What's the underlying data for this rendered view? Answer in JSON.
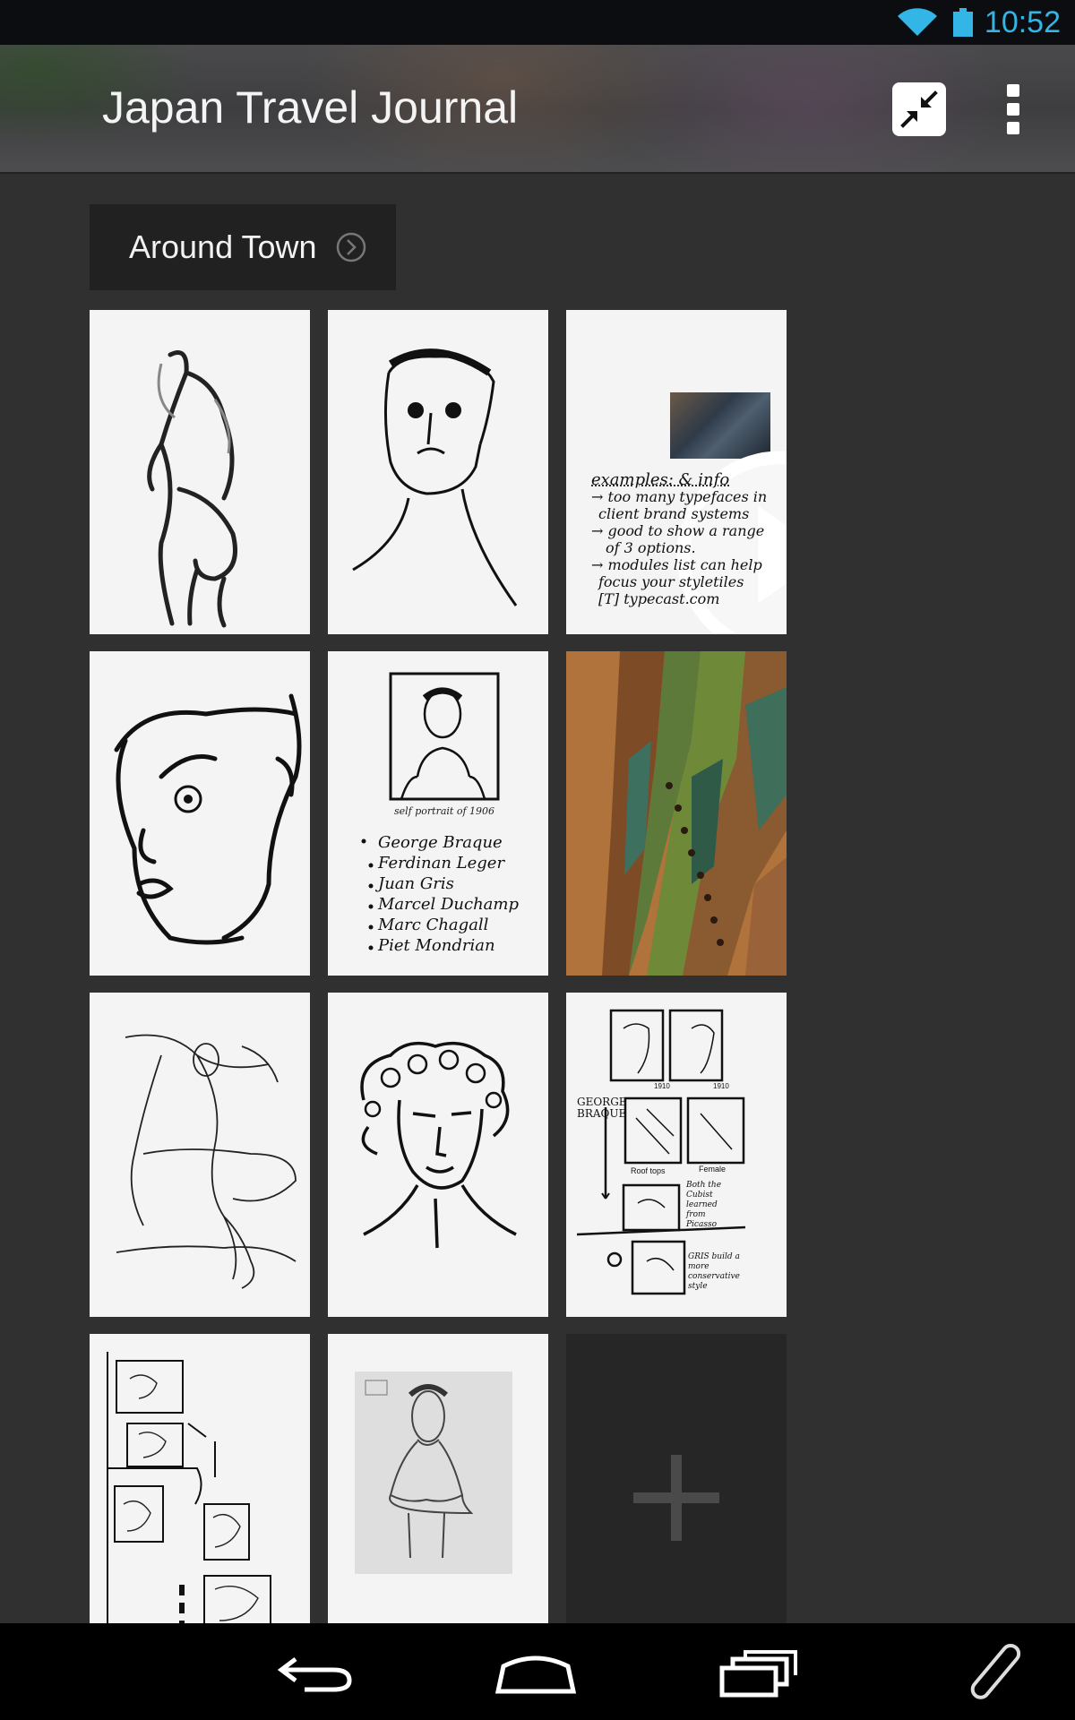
{
  "status_bar": {
    "time": "10:52",
    "icons": [
      "wifi-icon",
      "battery-icon"
    ],
    "accent_color": "#33b5e5"
  },
  "action_bar": {
    "title": "Japan Travel Journal",
    "actions": [
      "collapse-icon",
      "overflow-menu-icon"
    ]
  },
  "section": {
    "label": "Around Town",
    "icon": "chevron-right-circle-icon"
  },
  "notes_tile": {
    "heading": "examples: & info",
    "lines": [
      "→ too many typefaces in",
      "client brand systems",
      "→ good to show a range",
      "of 3 options.",
      "→ modules list can help",
      "focus your styletiles",
      "[T] typecast.com"
    ]
  },
  "list_tile": {
    "caption": "self portrait of 1906",
    "names": [
      "George Braque",
      "Ferdinan Leger",
      "Juan Gris",
      "Marcel Duchamp",
      "Marc Chagall",
      "Piet Mondrian"
    ]
  },
  "study_tile": {
    "side_label": "GEORGE BRAQUE",
    "captions": [
      "1910",
      "1910",
      "Roof tops",
      "Female",
      "Both the Cubist learned from Picasso",
      "GRIS build a more conservative style"
    ]
  },
  "add_tile": {
    "icon": "plus-icon"
  },
  "nav_bar": {
    "buttons": [
      "back-icon",
      "home-icon",
      "recents-icon",
      "stylus-icon"
    ]
  }
}
